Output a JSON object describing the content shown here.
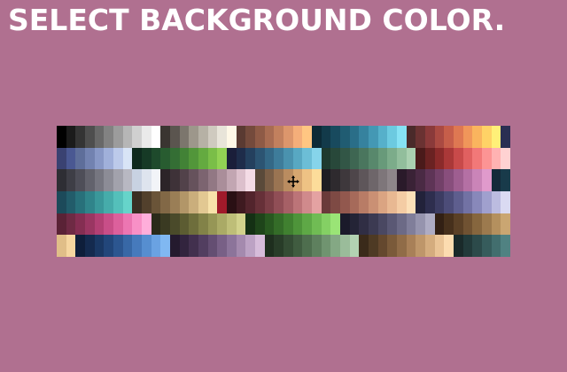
{
  "title": "SELECT BACKGROUND COLOR.",
  "colors": {
    "background": "#b07090",
    "title_text": "#ffffff"
  },
  "cursor": {
    "icon": "crosshair-move-cursor-icon"
  },
  "palette": {
    "groups": [
      [
        "#000000",
        "#1b1b1b",
        "#343434",
        "#4e4e4e",
        "#686868",
        "#828282",
        "#9c9c9c",
        "#b6b6b6",
        "#d0d0d0",
        "#eaeaea",
        "#ffffff"
      ],
      [
        "#3a3531",
        "#5b554f",
        "#7c766d",
        "#9d978b",
        "#b6b1a5",
        "#cfcabf",
        "#e8e4d9",
        "#fff8e7"
      ],
      [
        "#5a3a32",
        "#744a3c",
        "#8e5a46",
        "#a86c52",
        "#c2805e",
        "#dc966c",
        "#f4ae7a",
        "#ffc682"
      ],
      [
        "#0c2a36",
        "#123a4a",
        "#184a5e",
        "#205c72",
        "#2a6e88",
        "#36829e",
        "#4498b4",
        "#56b0ca",
        "#6ccae0",
        "#86e2f4"
      ],
      [
        "#4a2a2a",
        "#6a3232",
        "#8a3a3a",
        "#aa4a42",
        "#c65e4a",
        "#de7852",
        "#f0965a",
        "#fab45e",
        "#ffd266",
        "#fff078",
        "#2a2e52",
        "#3a4272",
        "#4a5892"
      ],
      [
        "#5e6e9a",
        "#7282b0",
        "#8898c6",
        "#a0b0da",
        "#bccaea",
        "#d8e4f6"
      ],
      [
        "#0e2a1e",
        "#163a26",
        "#1e4a2c",
        "#285c30",
        "#346e34",
        "#428236",
        "#52963a",
        "#64aa40",
        "#7abe48",
        "#92d254"
      ],
      [
        "#1a1e3a",
        "#1e2c4a",
        "#24405e",
        "#2c5472",
        "#346886",
        "#3e7c9a",
        "#4a92ae",
        "#58a8c2",
        "#6cbed6",
        "#86d4ea"
      ],
      [
        "#1e3a2e",
        "#28483a",
        "#325646",
        "#3e6652",
        "#4a765e",
        "#58886c",
        "#689a7a",
        "#7cac8a",
        "#92be9c",
        "#aad0b0"
      ],
      [
        "#4a1a1a",
        "#6a2222",
        "#8a2a2a",
        "#aa3838",
        "#c84a4a",
        "#e06060",
        "#f27878",
        "#fc9494",
        "#ffb2b2",
        "#ffd2d2"
      ],
      [
        "#2e2e34",
        "#3e3e46",
        "#4e4e58",
        "#62626c",
        "#767680",
        "#8c8c96",
        "#a2a2ac",
        "#b8b8c2"
      ],
      [
        "#c8d2e2",
        "#dee4ee",
        "#f2f4f8"
      ],
      [
        "#2c2428",
        "#3e3238",
        "#52424a",
        "#66525c",
        "#7c6470",
        "#927884",
        "#aa8e9a",
        "#c2a6b2",
        "#dcc0cc",
        "#f4dce6"
      ],
      [
        "#5a4a3a",
        "#7a5e46",
        "#9a7452",
        "#ba8c60",
        "#d6a670",
        "#eec284",
        "#fcdc9a"
      ],
      [
        "#1e1e22",
        "#2e2a2e",
        "#3e383c",
        "#4e464a",
        "#5e565a",
        "#6e666a",
        "#7e767a",
        "#8e868a"
      ],
      [
        "#2a1a2a",
        "#3a2236",
        "#4a2a44",
        "#5e3456",
        "#724068",
        "#884e7c",
        "#9e5e90",
        "#b470a4",
        "#ca84b8",
        "#e09acc"
      ],
      [
        "#142a3a",
        "#183a4a",
        "#1c4a5a",
        "#225c6a",
        "#28707a",
        "#30848a",
        "#3a989a",
        "#46acaa",
        "#54c0ba",
        "#66d4ca"
      ],
      [
        "#3a2e22",
        "#52402c",
        "#6a5438",
        "#826846",
        "#9a7e56",
        "#b29668",
        "#caae7c",
        "#e2c892",
        "#f8e2aa",
        "#a01a2a"
      ],
      [
        "#2a1014",
        "#3e1a20",
        "#52242c",
        "#663038",
        "#7a3e46",
        "#904e56",
        "#a66066",
        "#bc7478",
        "#d08a8c",
        "#e4a2a2"
      ],
      [
        "#6a3a3a",
        "#7e4a44",
        "#92584e",
        "#a66a5a",
        "#b87c66",
        "#ca9074",
        "#daa482",
        "#e8b892",
        "#f4cca4",
        "#fce0b8"
      ],
      [
        "#22223a",
        "#2e2e4e",
        "#3c3c62",
        "#4c4c78",
        "#5e5e8e",
        "#7272a4",
        "#8888ba",
        "#a0a0ce",
        "#bcbce0",
        "#dadaf2"
      ],
      [
        "#5a2236",
        "#6e2a44",
        "#842e52",
        "#9a3662",
        "#b24074",
        "#c84e88",
        "#dc609c",
        "#ec76b2",
        "#f890c6",
        "#ffaeda"
      ],
      [
        "#2a2a1a",
        "#3a3a22",
        "#4a4a2a",
        "#5c5c32",
        "#6e6e3c",
        "#828248",
        "#969656",
        "#aaaa66",
        "#bebe78",
        "#d2d28c"
      ],
      [
        "#143014",
        "#1e441a",
        "#285820",
        "#346c28",
        "#408030",
        "#4e943a",
        "#5ea846",
        "#70bc54",
        "#84d064",
        "#9ae476"
      ],
      [
        "#1a1a2a",
        "#242436",
        "#302e44",
        "#3c3a52",
        "#4a4862",
        "#5a5874",
        "#6c6a86",
        "#807e9a",
        "#9694ae",
        "#aeacc4"
      ],
      [
        "#322014",
        "#46301c",
        "#5a4026",
        "#705232",
        "#86663e",
        "#9c7a4e",
        "#b4905e",
        "#caa672",
        "#e0be88",
        "#f6d6a0"
      ],
      [
        "#0e1e3a",
        "#142a4e",
        "#1a3864",
        "#22467a",
        "#2c5690",
        "#3868a6",
        "#467abc",
        "#568ed0",
        "#6aa2e2",
        "#80b8f2"
      ],
      [
        "#241a2e",
        "#32243e",
        "#42304e",
        "#523e60",
        "#644e72",
        "#786086",
        "#8c749a",
        "#a48aae",
        "#bca2c4",
        "#d6bcda"
      ],
      [
        "#1e2e1e",
        "#283c28",
        "#344c34",
        "#405c40",
        "#4e6e4e",
        "#5e805e",
        "#709470",
        "#84a884",
        "#9abc9a",
        "#b2d2b2"
      ],
      [
        "#3a2a1a",
        "#4e3a24",
        "#64482e",
        "#7a5a3a",
        "#906c48",
        "#a88058",
        "#be966a",
        "#d4ac7e",
        "#eac496",
        "#fcdcb0"
      ],
      [
        "#1a2a2a",
        "#223a3a",
        "#2c4a4a",
        "#365c5c",
        "#426e6e",
        "#508282",
        "#609696",
        "#72aaaa",
        "#86bebe",
        "#9cd2d2"
      ],
      [
        "#3a1a3a",
        "#4e2250",
        "#642a66",
        "#7a347e",
        "#904096",
        "#a84eae",
        "#be60c4",
        "#d474d8",
        "#e88cea",
        "#f8a8f8"
      ],
      [
        "#2e2218",
        "#3e2e20",
        "#4e3c2a",
        "#604c36",
        "#725e44",
        "#867054",
        "#9a8466",
        "#b0987a",
        "#c6ae90",
        "#dcc6a8"
      ],
      [
        "#102a22",
        "#16382e",
        "#1e483c",
        "#28584a",
        "#326a5a",
        "#3e7e6c",
        "#4c9280",
        "#5ca694",
        "#70baaa",
        "#86cec0"
      ],
      [
        "#2a1e10",
        "#3a2a16",
        "#4c381e",
        "#5e4828",
        "#725a34",
        "#866c42",
        "#9c8052",
        "#b29464",
        "#c8aa78",
        "#dec08e"
      ],
      [
        "#3a3a5a",
        "#4a4a72",
        "#5c5c8a",
        "#7070a2",
        "#8686b8",
        "#9e9ece",
        "#b8b8e2",
        "#d4d4f4"
      ],
      [
        "#2a3a1a",
        "#3a4e22",
        "#4a622c",
        "#5c7838",
        "#6e8e46",
        "#82a456",
        "#98ba68",
        "#aed07c",
        "#c6e492",
        "#def6aa"
      ],
      [
        "#4a2a1a",
        "#623620",
        "#7a4428",
        "#925432",
        "#aa663e",
        "#c07a4c",
        "#d6905c",
        "#e8a870",
        "#f6c288",
        "#fedca4"
      ],
      [
        "#18182a",
        "#20203a",
        "#2a2a4c",
        "#36365e",
        "#444472",
        "#545486",
        "#66669a",
        "#7a7aae",
        "#9090c2",
        "#a8a8d6"
      ],
      [
        "#2e1a1a",
        "#402424",
        "#542e2e",
        "#683a3a",
        "#7e4848",
        "#945858",
        "#aa6a6a",
        "#c07e7e",
        "#d49494",
        "#e8acac"
      ],
      [
        "#1e3a4a",
        "#264a5e",
        "#305c72",
        "#3c6e86",
        "#4a829a",
        "#5a96ae",
        "#6caac0",
        "#82bed2",
        "#9ad0e2",
        "#b4e2f0"
      ],
      [
        "#3a2e10",
        "#4e3e16",
        "#64501e",
        "#7a6228",
        "#907634",
        "#a88a42",
        "#be9e52",
        "#d2b466",
        "#e6c87c",
        "#f8de96"
      ]
    ]
  }
}
